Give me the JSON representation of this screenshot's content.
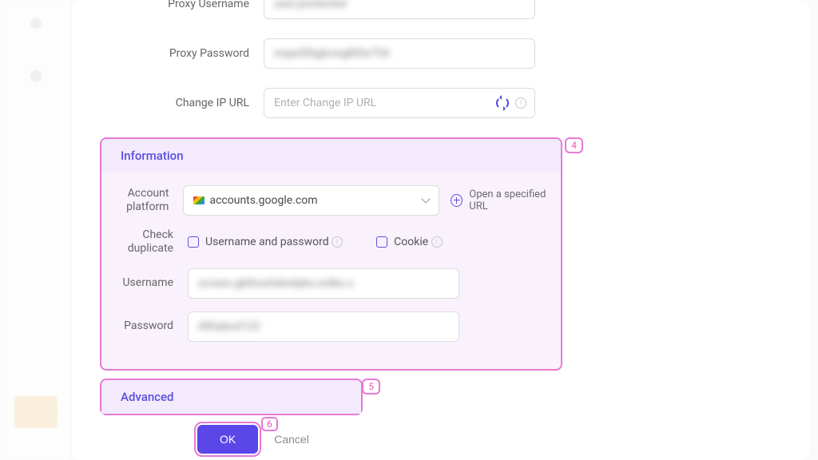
{
  "proxy": {
    "username_label": "Proxy Username",
    "username_value": "user.protected",
    "password_label": "Proxy Password",
    "password_value": "mqarIEkgbvwgM3e754",
    "changeip_label": "Change IP URL",
    "changeip_placeholder": "Enter Change IP URL"
  },
  "information": {
    "header": "Information",
    "tag": "4",
    "account_platform_label": "Account platform",
    "account_platform_value": "accounts.google.com",
    "open_url_label": "Open a specified URL",
    "check_duplicate_label": "Check duplicate",
    "dup_userpass": "Username and password",
    "dup_cookie": "Cookie",
    "username_label": "Username",
    "username_value": "screen.gkthushdmdyks.enlke.s",
    "password_label": "Password",
    "password_value": "ARtabcd123"
  },
  "advanced": {
    "header": "Advanced",
    "tag": "5"
  },
  "footer": {
    "ok": "OK",
    "ok_tag": "6",
    "cancel": "Cancel"
  }
}
